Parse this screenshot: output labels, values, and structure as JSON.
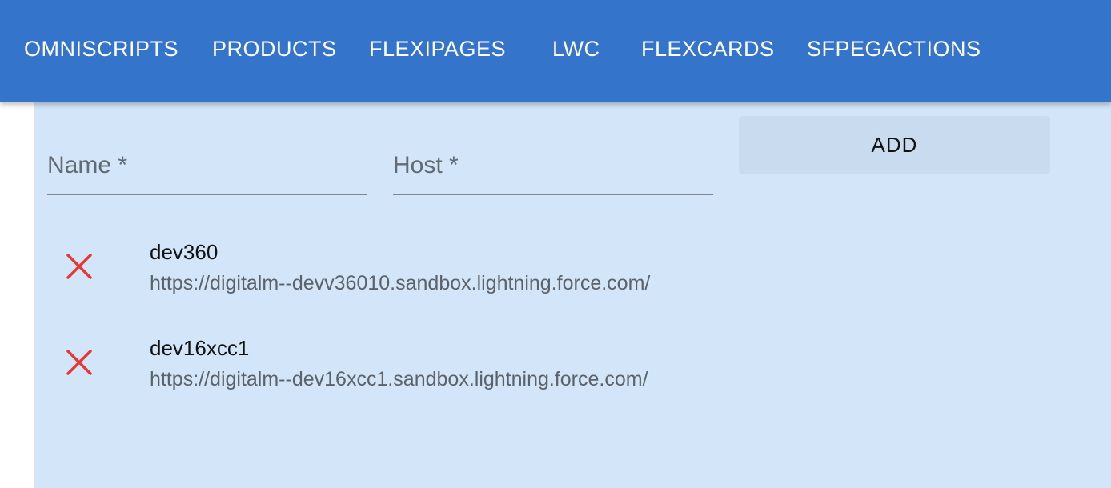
{
  "nav": {
    "tabs": [
      {
        "label": "OMNISCRIPTS"
      },
      {
        "label": "PRODUCTS"
      },
      {
        "label": "FLEXIPAGES"
      },
      {
        "label": "LWC"
      },
      {
        "label": "FLEXCARDS"
      },
      {
        "label": "SFPEGACTIONS"
      }
    ]
  },
  "form": {
    "name_label": "Name *",
    "name_value": "",
    "host_label": "Host *",
    "host_value": "",
    "add_label": "ADD"
  },
  "orgs": [
    {
      "name": "dev360",
      "host": "https://digitalm--devv36010.sandbox.lightning.force.com/"
    },
    {
      "name": "dev16xcc1",
      "host": "https://digitalm--dev16xcc1.sandbox.lightning.force.com/"
    }
  ],
  "icons": {
    "remove": "close-icon"
  },
  "colors": {
    "appbar": "#3574cb",
    "panel": "#d3e5f8",
    "add_button": "#c9dcef",
    "remove_icon": "#e53935"
  }
}
